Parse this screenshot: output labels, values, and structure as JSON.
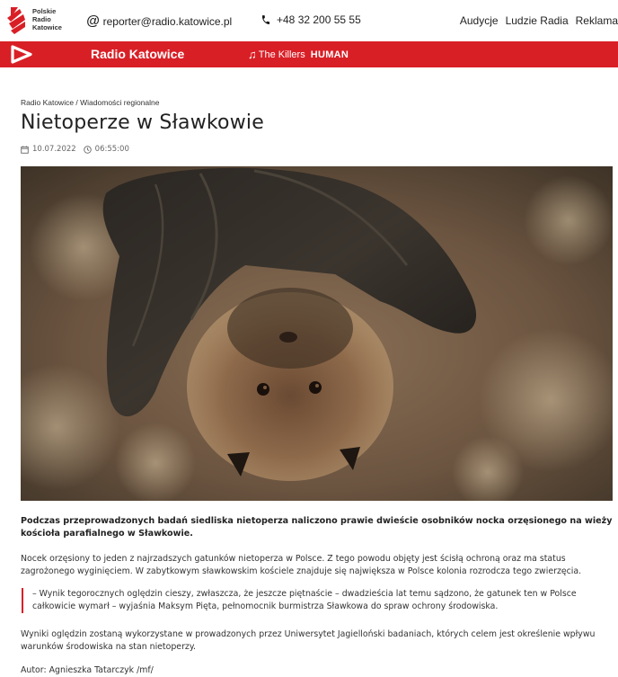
{
  "header": {
    "logo_lines": [
      "Polskie",
      "Radio",
      "Katowice"
    ],
    "email": "reporter@radio.katowice.pl",
    "phone": "+48 32 200 55 55",
    "nav": [
      "Audycje",
      "Ludzie Radia",
      "Reklama"
    ]
  },
  "player": {
    "station": "Radio Katowice",
    "artist": "The Killers",
    "song": "HUMAN"
  },
  "article": {
    "breadcrumb": "Radio Katowice / Wiadomości regionalne",
    "title": "Nietoperze w Sławkowie",
    "date": "10.07.2022",
    "time": "06:55:00",
    "lead": "Podczas przeprowadzonych badań siedliska nietoperza naliczono prawie dwieście osobników nocka orzęsionego na wieży kościoła parafialnego w Sławkowie.",
    "paragraph1": "Nocek orzęsiony to jeden z najrzadszych gatunków nietoperza w Polsce. Z tego powodu objęty jest ścisłą ochroną oraz ma status zagrożonego wyginięciem. W zabytkowym sławkowskim kościele znajduje się największa w Polsce kolonia rozrodcza tego zwierzęcia.",
    "quote": "– Wynik tegorocznych oględzin cieszy, zwłaszcza, że jeszcze piętnaście – dwadzieścia lat temu sądzono, że gatunek ten w Polsce całkowicie wymarł – wyjaśnia Maksym Pięta, pełnomocnik burmistrza Sławkowa do spraw ochrony środowiska.",
    "paragraph2": "Wyniki oględzin zostaną wykorzystane w prowadzonych przez Uniwersytet Jagielloński badaniach, których celem jest określenie wpływu warunków środowiska na stan nietoperzy.",
    "author": "Autor: Agnieszka Tatarczyk /mf/"
  },
  "colors": {
    "brand_red": "#d91f26"
  },
  "icons": [
    "logo-icon",
    "at-icon",
    "phone-icon",
    "play-icon",
    "music-note-icon",
    "calendar-icon",
    "clock-icon"
  ]
}
